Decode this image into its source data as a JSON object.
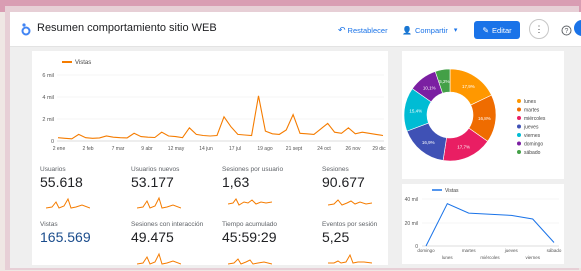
{
  "header": {
    "title": "Resumen comportamiento sitio WEB",
    "reset_label": "Restablecer",
    "share_label": "Compartir",
    "edit_label": "Editar"
  },
  "colors": {
    "accent": "#1a73e8",
    "series_orange": "#f57c00"
  },
  "main_chart": {
    "legend": "Vistas",
    "y_ticks": [
      "6 mil",
      "4 mil",
      "2 mil",
      "0"
    ],
    "x_ticks": [
      "2 ene",
      "2 feb",
      "7 mar",
      "9 abr",
      "12 may",
      "14 jun",
      "17 jul",
      "19 ago",
      "21 sept",
      "24 oct",
      "26 nov",
      "29 dic"
    ]
  },
  "metrics": [
    {
      "label": "Usuarios",
      "value": "55.618"
    },
    {
      "label": "Usuarios nuevos",
      "value": "53.177"
    },
    {
      "label": "Sesiones por usuario",
      "value": "1,63"
    },
    {
      "label": "Sesiones",
      "value": "90.677"
    },
    {
      "label": "Vistas",
      "value": "165.569"
    },
    {
      "label": "Sesiones con interacción",
      "value": "49.475"
    },
    {
      "label": "Tiempo acumulado",
      "value": "45:59:29"
    },
    {
      "label": "Eventos por sesión",
      "value": "5,25"
    }
  ],
  "chart_data": [
    {
      "type": "line",
      "series": [
        {
          "name": "Vistas",
          "values": [
            300,
            250,
            200,
            600,
            300,
            250,
            280,
            450,
            350,
            300,
            280,
            700,
            400,
            350,
            320,
            800,
            450,
            400,
            300,
            1200,
            600,
            500,
            450,
            500,
            2200,
            1300,
            600,
            550,
            500,
            4100,
            900,
            650,
            600,
            1000,
            2400,
            700,
            650,
            600,
            1100,
            1600,
            800,
            700,
            1200,
            650,
            800,
            700,
            600,
            500
          ]
        }
      ],
      "ylim": [
        0,
        6000
      ],
      "xlabel": "",
      "ylabel": ""
    },
    {
      "type": "pie",
      "categories": [
        "lunes",
        "martes",
        "miércoles",
        "jueves",
        "viernes",
        "domingo",
        "sábado"
      ],
      "values": [
        17.9,
        16.8,
        17.7,
        16.9,
        15.4,
        10.1,
        5.2
      ],
      "labels": [
        "17,9%",
        "16,8%",
        "17,7%",
        "16,9%",
        "15,4%",
        "10,1%",
        "5,2%"
      ],
      "colors": [
        "#ff9800",
        "#ef6c00",
        "#e91e63",
        "#3f51b5",
        "#00bcd4",
        "#7b1fa2",
        "#43a047"
      ],
      "legend": "right"
    },
    {
      "type": "line",
      "series": [
        {
          "name": "Vistas",
          "values": [
            0,
            36000,
            28000,
            27000,
            26000,
            23000,
            3000
          ]
        }
      ],
      "categories": [
        "domingo",
        "lunes",
        "martes",
        "miércoles",
        "jueves",
        "viernes",
        "sábado"
      ],
      "y_ticks": [
        "40 mil",
        "20 mil",
        "0"
      ],
      "ylim": [
        0,
        40000
      ]
    }
  ]
}
